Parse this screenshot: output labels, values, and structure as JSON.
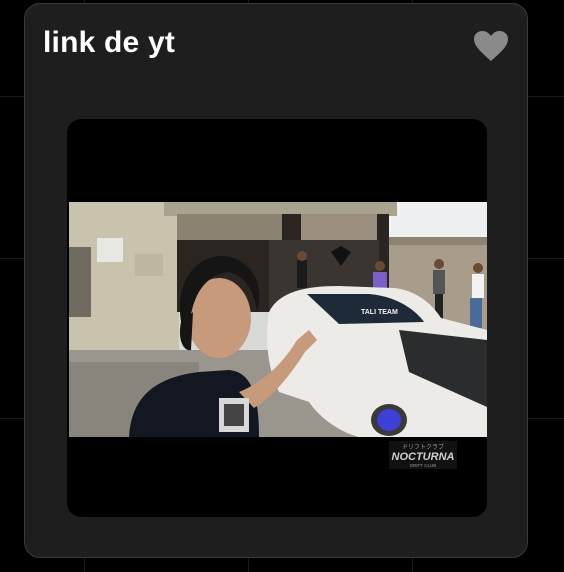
{
  "card": {
    "title": "link de yt",
    "favorite_icon": "heart-icon"
  },
  "video": {
    "thumbnail_icon": "video-thumbnail",
    "car_windshield_text": "TALI TEAM",
    "watermark_top": "ドリフトクラブ",
    "watermark_main": "NOCTURNA",
    "watermark_sub": "DRIFT CLUB"
  },
  "colors": {
    "background": "#000000",
    "card": "#1e1e1e",
    "card_border": "#3a3a3a",
    "title": "#ffffff",
    "heart": "#8a8a8a"
  }
}
